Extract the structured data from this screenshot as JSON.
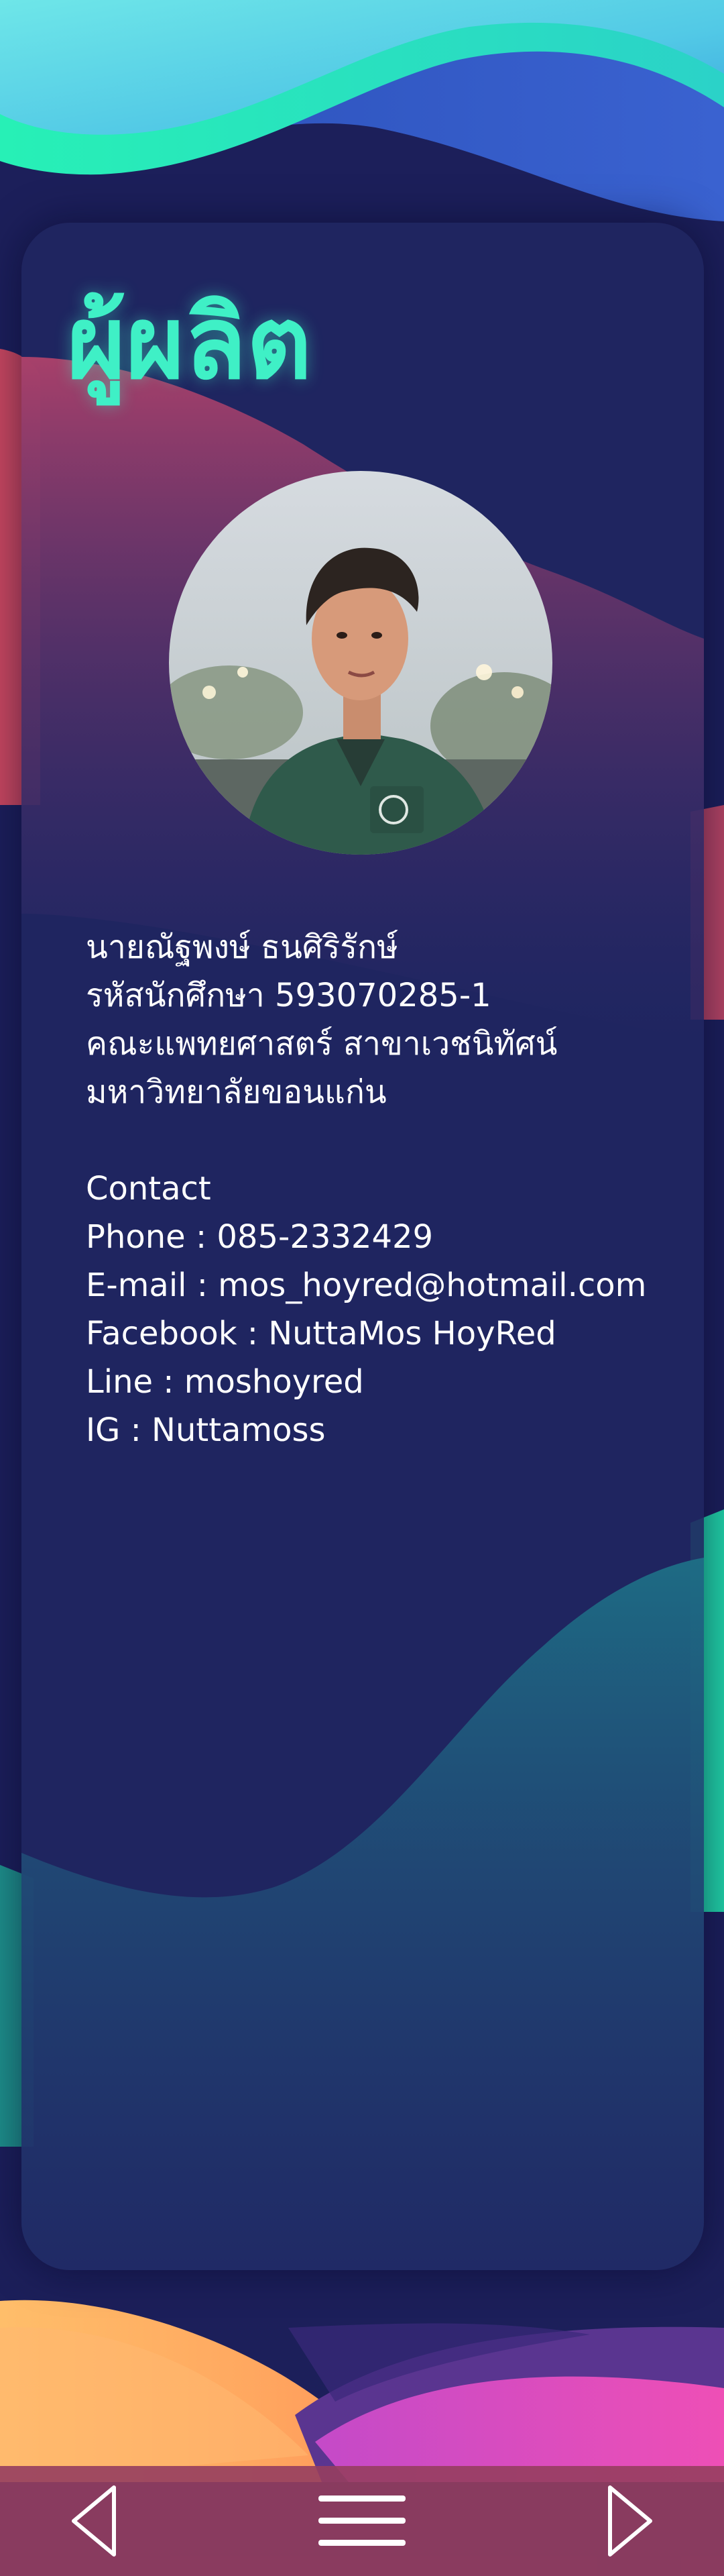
{
  "colors": {
    "background": "#1c1f5a",
    "card": "#202660",
    "title_accent": "#3ff0c6",
    "text": "#ffffff",
    "navbar": "#963e5f"
  },
  "page": {
    "title": "ผู้ผลิต"
  },
  "profile": {
    "photo_icon": "person-photo",
    "name": "นายณัฐพงษ์ ธนศิริรักษ์",
    "student_id": "รหัสนักศึกษา 593070285-1",
    "faculty": "คณะแพทยศาสตร์ สาขาเวชนิทัศน์",
    "university": "มหาวิทยาลัยขอนแก่น"
  },
  "contact": {
    "heading": "Contact",
    "phone": "Phone : 085-2332429",
    "email": "E-mail : mos_hoyred@hotmail.com",
    "facebook": "Facebook : NuttaMos HoyRed",
    "line": "Line : moshoyred",
    "ig": "IG : Nuttamoss"
  },
  "nav": {
    "back_icon": "triangle-left-icon",
    "menu_icon": "hamburger-menu-icon",
    "forward_icon": "triangle-right-icon"
  }
}
